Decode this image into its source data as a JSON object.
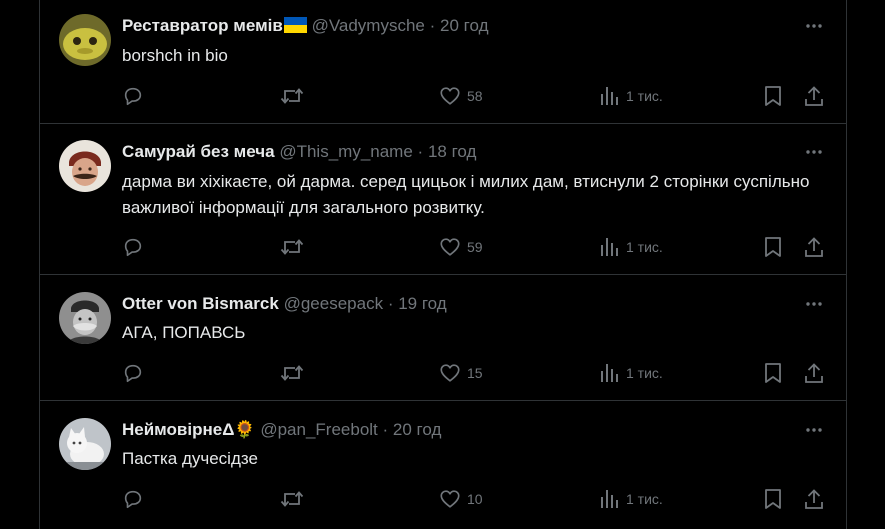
{
  "posts": [
    {
      "name": "Реставратор мемів",
      "handle": "@Vadymysche",
      "sep": "·",
      "time": "20 год",
      "text": "borshch in bio",
      "likes": "58",
      "views": "1 тис.",
      "flag_colors": [
        "#0057b7",
        "#ffd700"
      ]
    },
    {
      "name": "Самурай без меча",
      "handle": "@This_my_name",
      "sep": "·",
      "time": "18 год",
      "text": "дарма ви хіхікаєте, ой дарма. серед цицьок і милих дам, втиснули 2 сторінки суспільно важливої інформації для загального розвитку.",
      "likes": "59",
      "views": "1 тис."
    },
    {
      "name": "Otter von Bismarck",
      "handle": "@geesepack",
      "sep": "·",
      "time": "19 год",
      "text": "АГА, ПОПАВСЬ",
      "likes": "15",
      "views": "1 тис."
    },
    {
      "name": "НеймовірнеΔ🌻",
      "handle": "@pan_Freebolt",
      "sep": "·",
      "time": "20 год",
      "text": "Пастка дучесідзе",
      "likes": "10",
      "views": "1 тис."
    }
  ],
  "icons": {
    "reply": "reply-icon",
    "repost": "repost-icon",
    "like": "heart-icon",
    "views": "views-icon",
    "bookmark": "bookmark-icon",
    "share": "share-icon",
    "more": "more-icon"
  },
  "colors": {
    "background": "#000000",
    "text": "#e7e9ea",
    "muted": "#71767b",
    "border": "#2f3336"
  }
}
